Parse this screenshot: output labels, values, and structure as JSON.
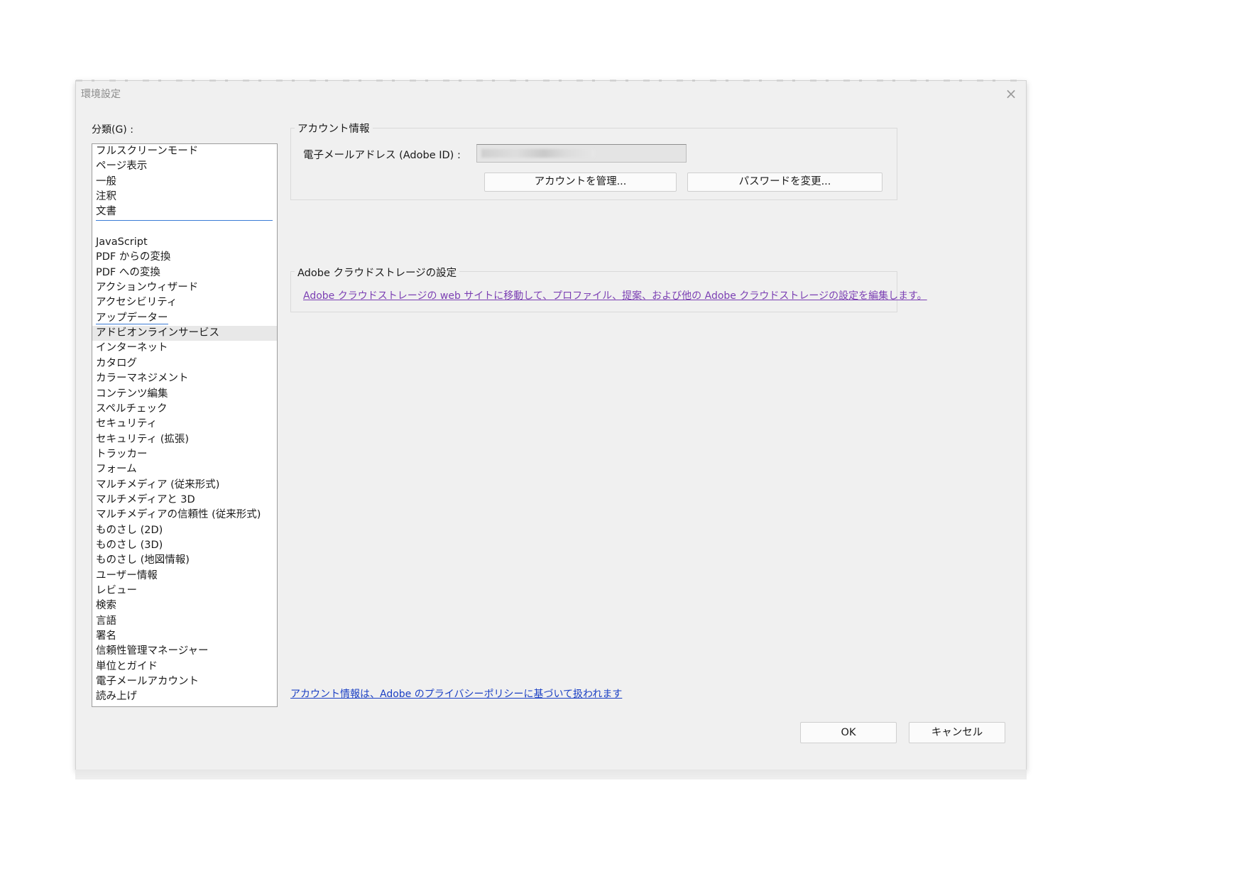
{
  "window": {
    "title": "環境設定",
    "close_symbol": "×"
  },
  "sidebar": {
    "label": "分類(G) :",
    "items_top": [
      "フルスクリーンモード",
      "ページ表示",
      "一般",
      "注釈",
      "文書"
    ],
    "items_bottom": [
      "JavaScript",
      "PDF からの変換",
      "PDF への変換",
      "アクションウィザード",
      "アクセシビリティ",
      "アップデーター",
      "アドビオンラインサービス",
      "インターネット",
      "カタログ",
      "カラーマネジメント",
      "コンテンツ編集",
      "スペルチェック",
      "セキュリティ",
      "セキュリティ (拡張)",
      "トラッカー",
      "フォーム",
      "マルチメディア (従来形式)",
      "マルチメディアと 3D",
      "マルチメディアの信頼性 (従来形式)",
      "ものさし (2D)",
      "ものさし (3D)",
      "ものさし (地図情報)",
      "ユーザー情報",
      "レビュー",
      "検索",
      "言語",
      "署名",
      "信頼性管理マネージャー",
      "単位とガイド",
      "電子メールアカウント",
      "読み上げ"
    ],
    "selected": "アドビオンラインサービス"
  },
  "account": {
    "group_title": "アカウント情報",
    "email_label": "電子メールアドレス (Adobe ID) :",
    "manage_button": "アカウントを管理...",
    "password_button": "パスワードを変更..."
  },
  "cloud": {
    "group_title": "Adobe クラウドストレージの設定",
    "link": "Adobe クラウドストレージの web サイトに移動して、プロファイル、提案、および他の Adobe クラウドストレージの設定を編集します。"
  },
  "privacy_link": "アカウント情報は、Adobe のプライバシーポリシーに基づいて扱われます",
  "footer": {
    "ok": "OK",
    "cancel": "キャンセル"
  },
  "colors": {
    "dialog_bg": "#f0f0f0",
    "link_purple": "#7b3fb3",
    "link_blue": "#1a3fc4",
    "accent": "#3a7bd5"
  }
}
